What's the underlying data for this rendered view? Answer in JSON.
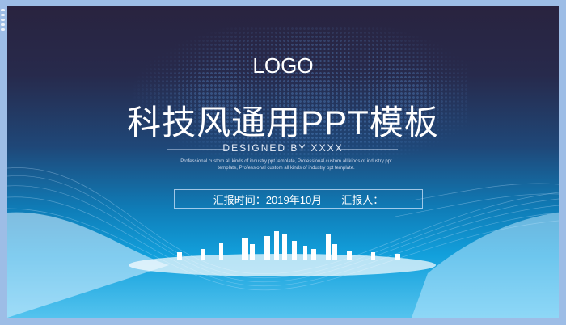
{
  "slide": {
    "logo": "LOGO",
    "title": "科技风通用PPT模板",
    "designed_by": "DESIGNED BY XXXX",
    "description": "Professional custom all kinds of industry ppt template, Professional custom all kinds of industry ppt template, Professional custom all kinds of industry ppt template.",
    "report_time": "汇报时间：2019年10月",
    "reporter": "汇报人："
  },
  "colors": {
    "frame": "#9dbde6",
    "top": "#29233f",
    "bottom": "#12a0dc"
  }
}
